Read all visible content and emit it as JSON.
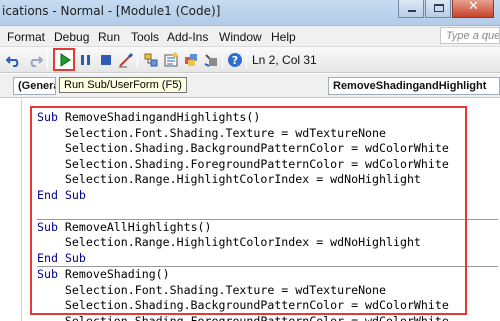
{
  "titlebar": {
    "title": "ications - Normal - [Module1 (Code)]"
  },
  "menubar": {
    "items": [
      {
        "label": "Format",
        "underline": ""
      },
      {
        "label": "Debug",
        "underline": ""
      },
      {
        "label": "Run",
        "underline": ""
      },
      {
        "label": "Tools",
        "underline": ""
      },
      {
        "label": "Add-Ins",
        "underline": ""
      },
      {
        "label": "Window",
        "underline": ""
      },
      {
        "label": "Help",
        "underline": ""
      }
    ],
    "question_placeholder": "Type a questi"
  },
  "toolbar": {
    "status": "Ln 2, Col 31",
    "run_tooltip": "Run Sub/UserForm (F5)",
    "icons": [
      "undo-icon",
      "redo-icon",
      "run-icon",
      "break-icon",
      "reset-icon",
      "design-mode-icon",
      "project-explorer-icon",
      "properties-icon",
      "object-browser-icon",
      "toolbox-icon",
      "help-icon"
    ],
    "accent_color": "#e53935"
  },
  "dropdowns": {
    "object": "(General)",
    "procedure": "RemoveShadingandHighlight"
  },
  "code": {
    "procedures": [
      {
        "lines": [
          {
            "kw": "Sub",
            "text": " RemoveShadingandHighlights()"
          },
          {
            "kw": "",
            "text": "    Selection.Font.Shading.Texture = wdTextureNone"
          },
          {
            "kw": "",
            "text": "    Selection.Shading.BackgroundPatternColor = wdColorWhite"
          },
          {
            "kw": "",
            "text": "    Selection.Shading.ForegroundPatternColor = wdColorWhite"
          },
          {
            "kw": "",
            "text": "    Selection.Range.HighlightColorIndex = wdNoHighlight"
          },
          {
            "kw": "End Sub",
            "text": ""
          },
          {
            "kw": "",
            "text": ""
          }
        ]
      },
      {
        "lines": [
          {
            "kw": "Sub",
            "text": " RemoveAllHighlights()"
          },
          {
            "kw": "",
            "text": "    Selection.Range.HighlightColorIndex = wdNoHighlight"
          },
          {
            "kw": "End Sub",
            "text": ""
          }
        ]
      },
      {
        "lines": [
          {
            "kw": "Sub",
            "text": " RemoveShading()"
          },
          {
            "kw": "",
            "text": "    Selection.Font.Shading.Texture = wdTextureNone"
          },
          {
            "kw": "",
            "text": "    Selection.Shading.BackgroundPatternColor = wdColorWhite"
          },
          {
            "kw": "",
            "text": "    Selection.Shading.ForegroundPatternColor = wdColorWhite"
          }
        ]
      }
    ]
  }
}
